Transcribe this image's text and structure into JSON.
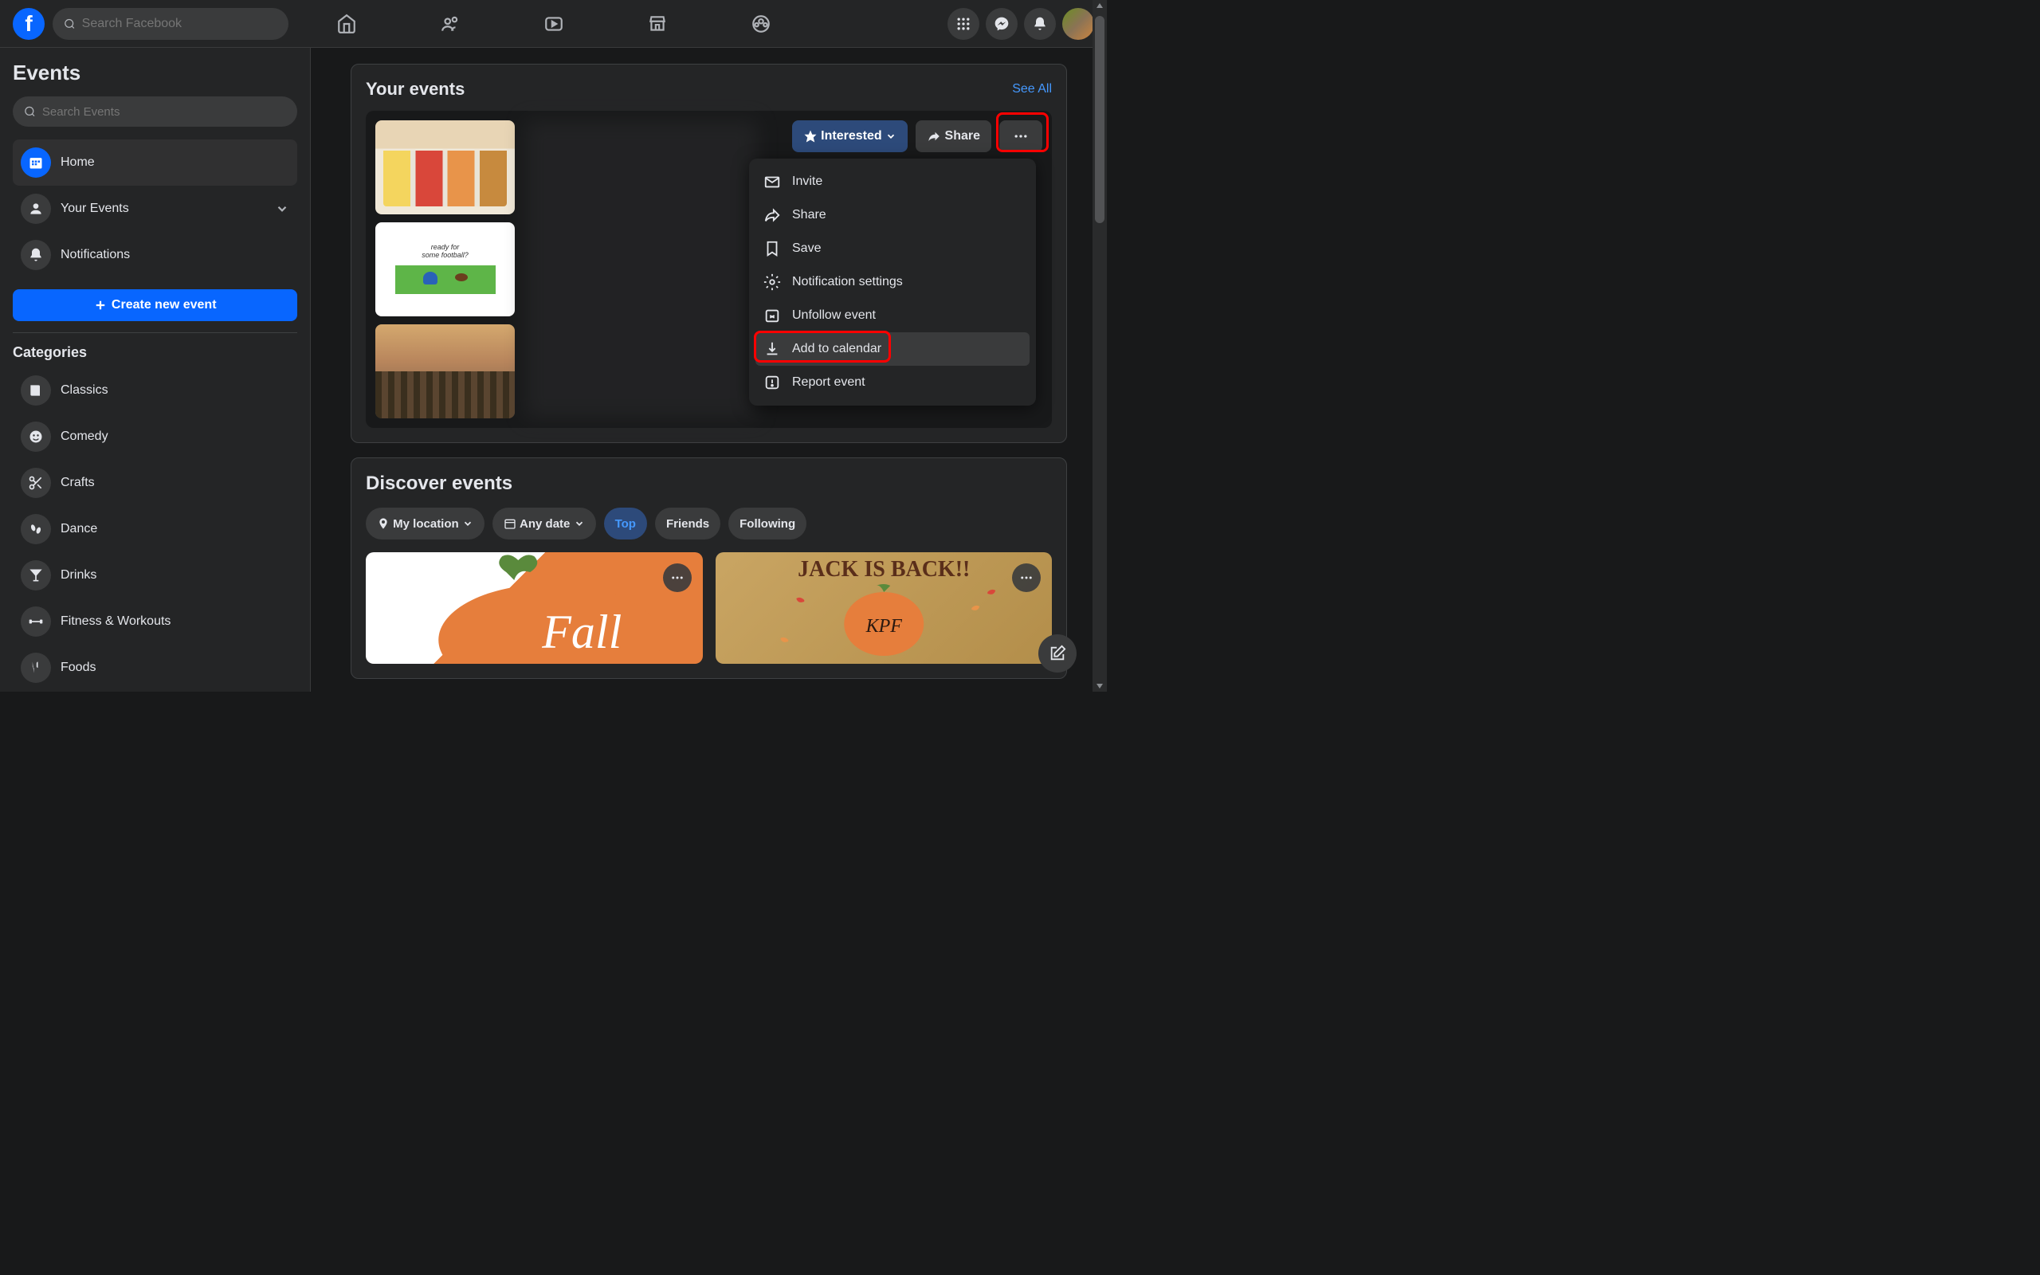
{
  "topNav": {
    "searchPlaceholder": "Search Facebook"
  },
  "sidebar": {
    "title": "Events",
    "searchPlaceholder": "Search Events",
    "items": {
      "home": "Home",
      "yourEvents": "Your Events",
      "notifications": "Notifications"
    },
    "createBtn": "Create new event",
    "categoriesTitle": "Categories",
    "categories": [
      "Classics",
      "Comedy",
      "Crafts",
      "Dance",
      "Drinks",
      "Fitness & Workouts",
      "Foods"
    ]
  },
  "yourEvents": {
    "title": "Your events",
    "seeAll": "See All",
    "interested": "Interested",
    "share": "Share",
    "footballText1": "ready for",
    "footballText2": "some football?"
  },
  "dropdown": {
    "invite": "Invite",
    "share": "Share",
    "save": "Save",
    "notificationSettings": "Notification settings",
    "unfollow": "Unfollow event",
    "addCalendar": "Add to calendar",
    "report": "Report event"
  },
  "discover": {
    "title": "Discover events",
    "myLocation": "My location",
    "anyDate": "Any date",
    "top": "Top",
    "friends": "Friends",
    "following": "Following",
    "card1Text": "Fall",
    "card2Text": "JACK IS BACK!!",
    "card2Logo": "KPF"
  }
}
